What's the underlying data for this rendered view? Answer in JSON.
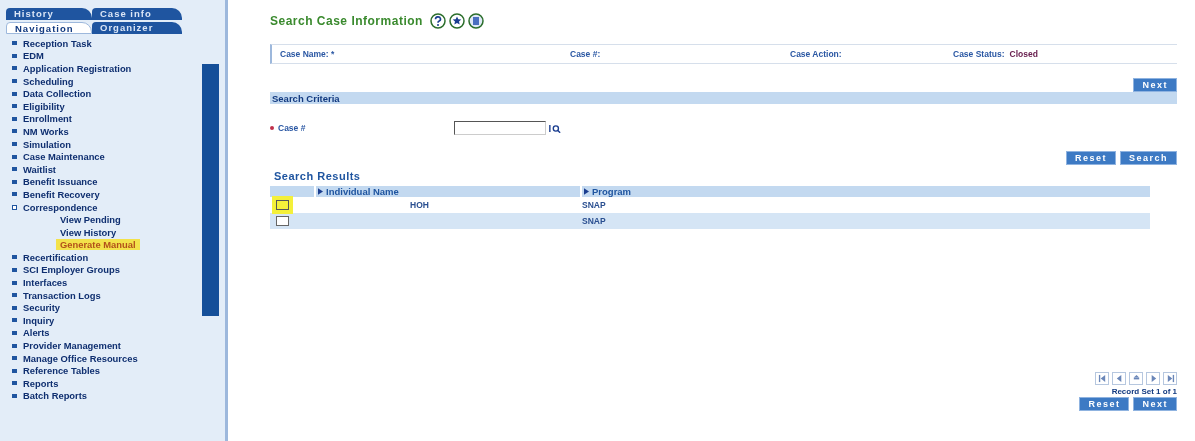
{
  "sidebar": {
    "tabs": [
      {
        "label": "History",
        "selected": false
      },
      {
        "label": "Case info",
        "selected": false
      },
      {
        "label": "Navigation",
        "selected": true
      },
      {
        "label": "Organizer",
        "selected": false
      }
    ],
    "items": [
      {
        "label": "Reception Task"
      },
      {
        "label": "EDM"
      },
      {
        "label": "Application Registration"
      },
      {
        "label": "Scheduling"
      },
      {
        "label": "Data Collection"
      },
      {
        "label": "Eligibility"
      },
      {
        "label": "Enrollment"
      },
      {
        "label": "NM Works"
      },
      {
        "label": "Simulation"
      },
      {
        "label": "Case Maintenance"
      },
      {
        "label": "Waitlist"
      },
      {
        "label": "Benefit Issuance"
      },
      {
        "label": "Benefit Recovery"
      },
      {
        "label": "Correspondence",
        "expanded": true,
        "children": [
          {
            "label": "View Pending",
            "selected": false
          },
          {
            "label": "View History",
            "selected": false
          },
          {
            "label": "Generate Manual",
            "selected": true
          }
        ]
      },
      {
        "label": "Recertification"
      },
      {
        "label": "SCI Employer Groups"
      },
      {
        "label": "Interfaces"
      },
      {
        "label": "Transaction Logs"
      },
      {
        "label": "Security"
      },
      {
        "label": "Inquiry"
      },
      {
        "label": "Alerts"
      },
      {
        "label": "Provider Management"
      },
      {
        "label": "Manage Office Resources"
      },
      {
        "label": "Reference Tables"
      },
      {
        "label": "Reports"
      },
      {
        "label": "Batch Reports"
      }
    ]
  },
  "page": {
    "title": "Search Case Information",
    "case_info": {
      "name_label": "Case Name:",
      "name_mark": "*",
      "number_label": "Case #:",
      "action_label": "Case Action:",
      "status_label": "Case Status:",
      "status_value": "Closed"
    },
    "top_button": "Next",
    "criteria": {
      "title": "Search Criteria",
      "field_label": "Case #",
      "required": true
    },
    "criteria_buttons": [
      "Reset",
      "Search"
    ],
    "results": {
      "title": "Search Results",
      "columns": [
        "Individual Name",
        "Program"
      ],
      "rows": [
        {
          "selected": true,
          "relationship": "HOH",
          "program": "SNAP"
        },
        {
          "selected": false,
          "program": "SNAP"
        }
      ]
    },
    "record_set": "Record Set 1 of 1",
    "bottom_buttons": [
      "Reset",
      "Next"
    ]
  }
}
